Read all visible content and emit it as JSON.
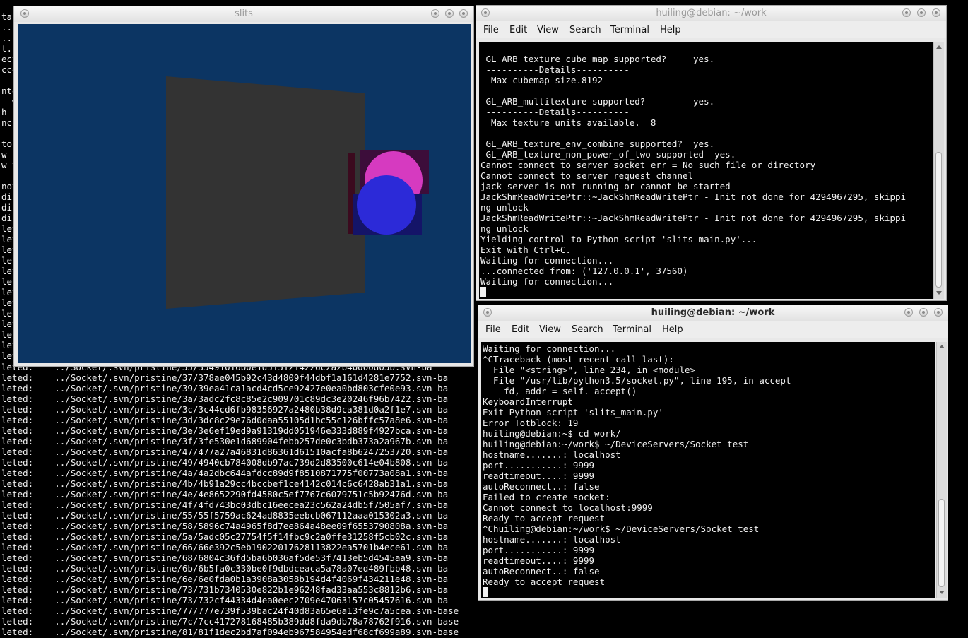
{
  "background_terminal": {
    "left_fragments": [
      "tab",
      "...",
      "..",
      "t.",
      "ect",
      "cce",
      "",
      "nte",
      "  w",
      "h n",
      "nch",
      "",
      "to",
      "w t",
      "w t",
      "",
      "not",
      "dif",
      "dif",
      "dif",
      "let",
      "let",
      "let",
      "let",
      "let",
      "let",
      "let",
      "let",
      "let",
      "let",
      "let",
      "let",
      "let"
    ],
    "rows": [
      "leted:    ../Socket/.svn/pristine/35/35491016b0e1d5151214226c2a2b40d00d05b.svn-ba",
      "leted:    ../Socket/.svn/pristine/37/378ae045b92c43d4809f44dbf1a161d4281e7752.svn-ba",
      "leted:    ../Socket/.svn/pristine/39/39ea41ca1acd4cd5ce92427e0ea0bd803cfe0e93.svn-ba",
      "leted:    ../Socket/.svn/pristine/3a/3adc2fc8c85e2c909701c89dc3e20246f96b7422.svn-ba",
      "leted:    ../Socket/.svn/pristine/3c/3c44cd6fb98356927a2480b38d9ca381d0a2f1e7.svn-ba",
      "leted:    ../Socket/.svn/pristine/3d/3dc8c29e76d0daa55105d1bc55c126bffc57a8e6.svn-ba",
      "leted:    ../Socket/.svn/pristine/3e/3e6ef19ed9a91319dd051946e333d889f4927bca.svn-ba",
      "leted:    ../Socket/.svn/pristine/3f/3fe530e1d689904febb257de0c3bdb373a2a967b.svn-ba",
      "leted:    ../Socket/.svn/pristine/47/477a27a46831d86361d61510acfa8b6247253720.svn-ba",
      "leted:    ../Socket/.svn/pristine/49/4940cb784008db97ac739d2d83500c614e04b808.svn-ba",
      "leted:    ../Socket/.svn/pristine/4a/4a2dbc644afdcc89d9f8510871775f00773a08a1.svn-ba",
      "leted:    ../Socket/.svn/pristine/4b/4b91a29cc4bccbef1ce4142c014c6c6428ab31a1.svn-ba",
      "leted:    ../Socket/.svn/pristine/4e/4e8652290fd4580c5ef7767c6079751c5b92476d.svn-ba",
      "leted:    ../Socket/.svn/pristine/4f/4fd743bc03dbc16eecea23c562a24db5f7505af7.svn-ba",
      "leted:    ../Socket/.svn/pristine/55/55f5759ac624ad8835eebcb067112aaa015302a3.svn-ba",
      "leted:    ../Socket/.svn/pristine/58/5896c74a4965f8d7ee864a48ee09f6553790808a.svn-ba",
      "leted:    ../Socket/.svn/pristine/5a/5adc05c27754f5f14fbc9c2a0ffe31258f5cb02c.svn-ba",
      "leted:    ../Socket/.svn/pristine/66/66e392c5eb19022017628113822ea5701b4ece61.svn-ba",
      "leted:    ../Socket/.svn/pristine/68/6804c36fd5ba6b036af5de53f7413eb5d4545aa9.svn-ba",
      "leted:    ../Socket/.svn/pristine/6b/6b5fa0c330be0f9dbdceaca5a78a07ed489fbb48.svn-ba",
      "leted:    ../Socket/.svn/pristine/6e/6e0fda0b1a3908a3058b194d4f4069f434211e48.svn-ba",
      "leted:    ../Socket/.svn/pristine/73/731b7340530e822b1e96248fad33aa553c8812b6.svn-ba",
      "leted:    ../Socket/.svn/pristine/73/732cf44334d4ea0eec2709e47063157c05457616.svn-ba",
      "leted:    ../Socket/.svn/pristine/77/777e739f539bac24f40d83a65e6a13fe9c7a5cea.svn-base",
      "leted:    ../Socket/.svn/pristine/7c/7cc417278168485b389dd8fda9db78a78762f916.svn-base",
      "leted:    ../Socket/.svn/pristine/81/81f1dec2bd7af094eb967584954edf68cf699a89.svn-base"
    ]
  },
  "slits_window": {
    "title": "slits",
    "scene_colors": {
      "background": "#0c3563",
      "panel": "#333333",
      "pink": "#d63ac0",
      "blue": "#2c2ad8"
    }
  },
  "terminal_top": {
    "title": "huiling@debian: ~/work",
    "menu": [
      "File",
      "Edit",
      "View",
      "Search",
      "Terminal",
      "Help"
    ],
    "lines": [
      " GL_ARB_texture_cube_map supported?     yes.",
      " ----------Details----------",
      "  Max cubemap size.8192",
      "",
      " GL_ARB_multitexture supported?         yes.",
      " ----------Details----------",
      "  Max texture units available.  8",
      "",
      " GL_ARB_texture_env_combine supported?  yes.",
      " GL_ARB_texture_non_power_of_two supported  yes.",
      "Cannot connect to server socket err = No such file or directory",
      "Cannot connect to server request channel",
      "jack server is not running or cannot be started",
      "JackShmReadWritePtr::~JackShmReadWritePtr - Init not done for 4294967295, skippi",
      "ng unlock",
      "JackShmReadWritePtr::~JackShmReadWritePtr - Init not done for 4294967295, skippi",
      "ng unlock",
      "Yielding control to Python script 'slits_main.py'...",
      "Exit with Ctrl+C.",
      "Waiting for connection...",
      "...connected from: ('127.0.0.1', 37560)",
      "Waiting for connection..."
    ]
  },
  "terminal_bottom": {
    "title": "huiling@debian: ~/work",
    "menu": [
      "File",
      "Edit",
      "View",
      "Search",
      "Terminal",
      "Help"
    ],
    "lines": [
      "Waiting for connection...",
      "^CTraceback (most recent call last):",
      "  File \"<string>\", line 234, in <module>",
      "  File \"/usr/lib/python3.5/socket.py\", line 195, in accept",
      "    fd, addr = self._accept()",
      "KeyboardInterrupt",
      "Exit Python script 'slits_main.py'",
      "Error Totblock: 19",
      "huiling@debian:~$ cd work/",
      "huiling@debian:~/work$ ~/DeviceServers/Socket test",
      "hostname.......: localhost",
      "port...........: 9999",
      "readtimeout....: 9999",
      "autoReconnect..: false",
      "Failed to create socket:",
      "Cannot connect to localhost:9999",
      "Ready to accept request",
      "^Chuiling@debian:~/work$ ~/DeviceServers/Socket test",
      "hostname.......: localhost",
      "port...........: 9999",
      "readtimeout....: 9999",
      "autoReconnect..: false",
      "Ready to accept request"
    ]
  }
}
